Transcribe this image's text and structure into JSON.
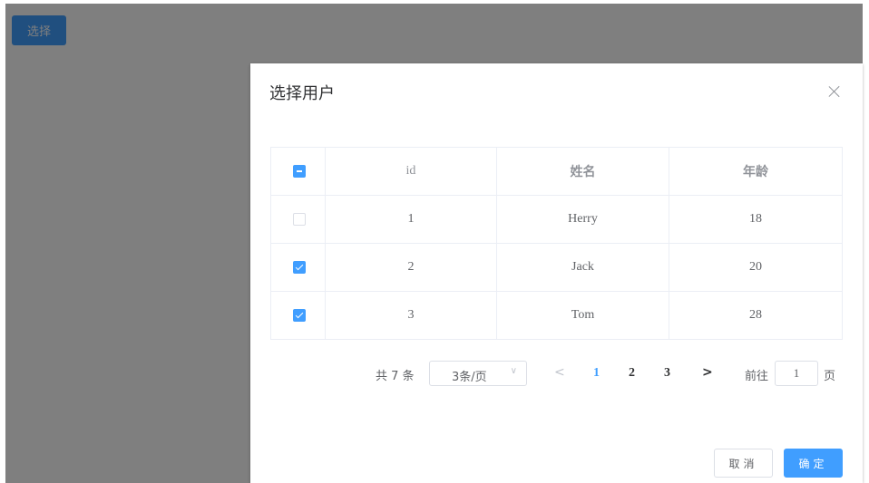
{
  "page": {
    "open_button_label": "选择"
  },
  "dialog": {
    "title": "选择用户",
    "close_icon": "close-icon",
    "table": {
      "header_checkbox_state": "indeterminate",
      "columns": [
        "id",
        "姓名",
        "年龄"
      ],
      "rows": [
        {
          "checked": false,
          "id": "1",
          "name": "Herry",
          "age": "18"
        },
        {
          "checked": true,
          "id": "2",
          "name": "Jack",
          "age": "20"
        },
        {
          "checked": true,
          "id": "3",
          "name": "Tom",
          "age": "28"
        }
      ]
    },
    "pagination": {
      "total_label": "共 7 条",
      "page_size_label": "3条/页",
      "prev_icon": "chevron-left-icon",
      "pages": [
        "1",
        "2",
        "3"
      ],
      "current_page": "1",
      "next_icon": "chevron-right-icon",
      "goto_label": "前往",
      "jump_value": "1",
      "page_suffix": "页"
    },
    "footer": {
      "cancel_label": "取消",
      "confirm_label": "确定"
    }
  },
  "colors": {
    "primary": "#409eff",
    "overlay": "rgba(0,0,0,0.5)",
    "border": "#ebeef5"
  }
}
